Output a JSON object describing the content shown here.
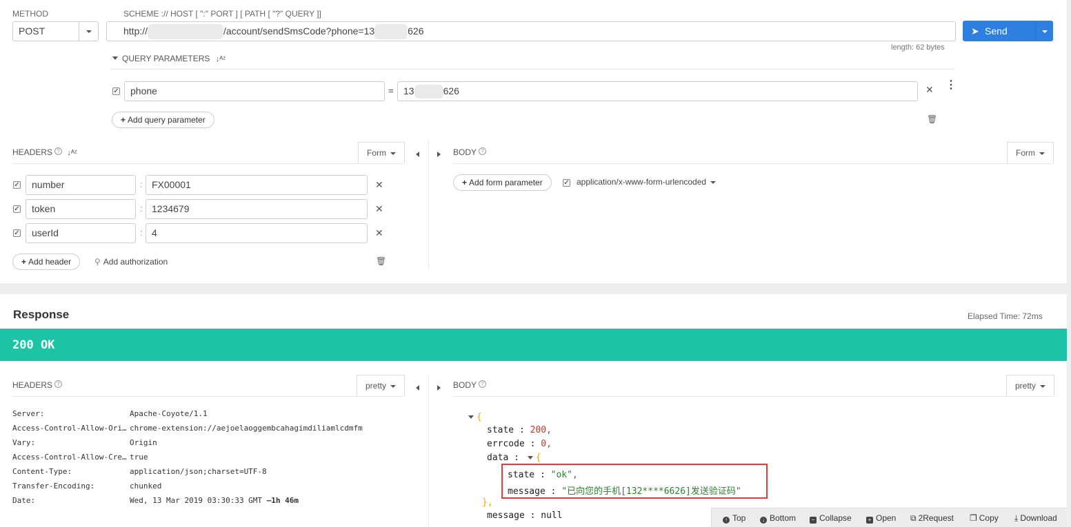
{
  "request": {
    "method_label": "METHOD",
    "method_value": "POST",
    "url_label": "SCHEME :// HOST [ \":\" PORT ] [ PATH [ \"?\" QUERY ]]",
    "url_prefix": "http://",
    "url_path": "/account/sendSmsCode?phone=13",
    "url_suffix": "626",
    "length_text": "length: 62 bytes",
    "send_label": "Send",
    "query_section_label": "QUERY PARAMETERS",
    "query_params": [
      {
        "name": "phone",
        "value_prefix": "13",
        "value_suffix": "626"
      }
    ],
    "query_eq": "=",
    "add_query_label": "Add query parameter",
    "headers_label": "HEADERS",
    "headers_mode": "Form",
    "headers": [
      {
        "name": "number",
        "value": "FX00001"
      },
      {
        "name": "token",
        "value": "1234679"
      },
      {
        "name": "userId",
        "value": "4"
      }
    ],
    "header_sep": ":",
    "add_header_label": "Add header",
    "add_auth_label": "Add authorization",
    "body_label": "BODY",
    "body_mode": "Form",
    "add_form_label": "Add form parameter",
    "content_type": "application/x-www-form-urlencoded"
  },
  "response": {
    "title": "Response",
    "elapsed": "Elapsed Time: 72ms",
    "status": "200 OK",
    "status_color": "#1cc3a6",
    "headers_label": "HEADERS",
    "headers_mode": "pretty",
    "body_label": "BODY",
    "body_mode": "pretty",
    "headers": [
      {
        "name": "Server:",
        "value": "Apache-Coyote/1.1"
      },
      {
        "name": "Access-Control-Allow-Ori…",
        "value": "chrome-extension://aejoelaoggembcahagimdiliamlcdmfm"
      },
      {
        "name": "Vary:",
        "value": "Origin"
      },
      {
        "name": "Access-Control-Allow-Cre…",
        "value": "true"
      },
      {
        "name": "Content-Type:",
        "value": "application/json;charset=UTF-8"
      },
      {
        "name": "Transfer-Encoding:",
        "value": "chunked"
      },
      {
        "name": "Date:",
        "value": "Wed, 13 Mar 2019 03:30:33 GMT",
        "extra": "—1h 46m"
      }
    ],
    "json": {
      "state_key": "state",
      "state_val": "200,",
      "errcode_key": "errcode",
      "errcode_val": "0,",
      "data_key": "data",
      "inner_state_key": "state",
      "inner_state_val": "\"ok\",",
      "inner_message_key": "message",
      "inner_message_val": "\"已向您的手机[132****6626]发送验证码\"",
      "close_inner": "},",
      "message_key": "message",
      "message_val": "null",
      "open_brace": "{",
      "colon": ":"
    }
  },
  "toolbar": {
    "top": "Top",
    "bottom": "Bottom",
    "collapse": "Collapse",
    "open": "Open",
    "request2": "2Request",
    "copy": "Copy",
    "download": "Download"
  }
}
